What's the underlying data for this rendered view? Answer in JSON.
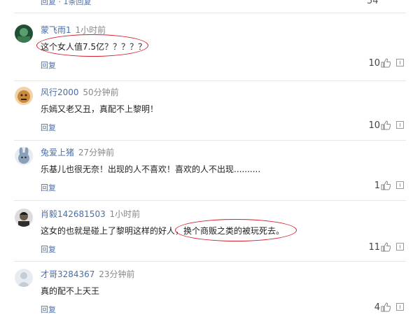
{
  "top_partial": {
    "reply_label": "回复 · 1条回复",
    "likes": "54"
  },
  "comments": [
    {
      "user": "蒙飞雨1",
      "time": "1小时前",
      "text": "这个女人值7.5亿？？？？？",
      "reply_label": "回复",
      "likes": "10",
      "avatar_color": "#2f6d4a"
    },
    {
      "user": "风行2000",
      "time": "50分钟前",
      "text": "乐嫣又老又丑，真配不上黎明！",
      "reply_label": "回复",
      "likes": "10",
      "avatar_color": "#c98a3c"
    },
    {
      "user": "兔爱上猪",
      "time": "27分钟前",
      "text": "乐基儿也很无奈！出现的人不喜欢！喜欢的人不出现..........",
      "reply_label": "回复",
      "likes": "1",
      "avatar_color": "#8aa0b8"
    },
    {
      "user": "肖毅142681503",
      "time": "1小时前",
      "text": "这女的也就是碰上了黎明这样的好人，换个商贩之类的被玩死去。",
      "reply_label": "回复",
      "likes": "11",
      "avatar_color": "#3a3a3a"
    },
    {
      "user": "才哥3284367",
      "time": "23分钟前",
      "text": "真的配不上天王",
      "reply_label": "回复",
      "likes": "4",
      "avatar_color": "#c4ccd6"
    }
  ],
  "colors": {
    "link": "#4b6ea8",
    "annotation": "#d61d2a"
  },
  "icons": {
    "like": "thumbs-up-icon",
    "more": "more-box-icon"
  }
}
